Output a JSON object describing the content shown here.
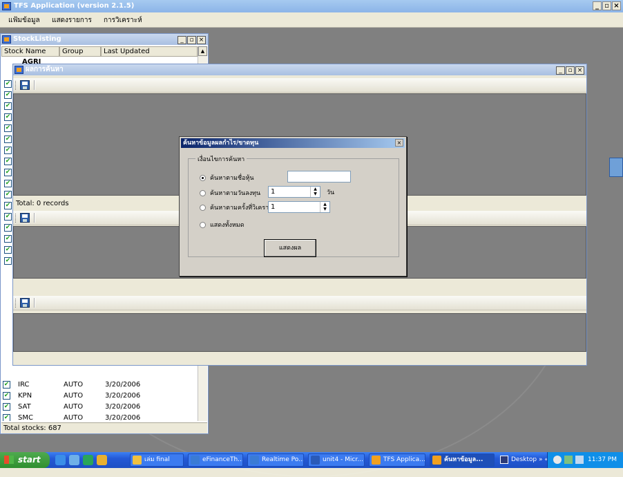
{
  "app": {
    "title": "TFS Application (version 2.1.5)",
    "minimize": "_",
    "restore": "▫",
    "close": "×"
  },
  "menu": {
    "items": [
      "แฟ้มข้อมูล",
      "แสดงรายการ",
      "การวิเคราะห์"
    ]
  },
  "stock_window": {
    "title": "StockListing",
    "columns": [
      "Stock Name",
      "Group",
      "Last Updated"
    ],
    "first_row": "AGRI",
    "rows": [
      {
        "name": "IRC",
        "group": "AUTO",
        "date": "3/20/2006"
      },
      {
        "name": "KPN",
        "group": "AUTO",
        "date": "3/20/2006"
      },
      {
        "name": "SAT",
        "group": "AUTO",
        "date": "3/20/2006"
      },
      {
        "name": "SMC",
        "group": "AUTO",
        "date": "3/20/2006"
      }
    ],
    "total": "Total stocks: 687"
  },
  "result_window": {
    "title": "ผลการค้นหา",
    "records_label": "Total: 0 records"
  },
  "dialog": {
    "title": "ค้นหาข้อมูลผลกำไร/ขาดทุน",
    "group_label": "เงื่อนไขการค้นหา",
    "options": [
      {
        "label": "ค้นหาตามชื่อหุ้น",
        "selected": true
      },
      {
        "label": "ค้นหาตามวันลงทุน",
        "selected": false
      },
      {
        "label": "ค้นหาตามครั้งที่วิเคราะห์",
        "selected": false
      },
      {
        "label": "แสดงทั้งหมด",
        "selected": false
      }
    ],
    "stock_name_value": "",
    "days_value": "1",
    "days_unit": "วัน",
    "analysis_value": "1",
    "button_label": "แสดงผล"
  },
  "taskbar": {
    "start_label": "start",
    "buttons": [
      {
        "label": "เล่ม final",
        "active": false,
        "color": "#f0c040"
      },
      {
        "label": "eFinanceTh...",
        "active": false,
        "color": "#3a7bd5"
      },
      {
        "label": "Realtime Po...",
        "active": false,
        "color": "#3a7bd5"
      },
      {
        "label": "unit4 - Micr...",
        "active": false,
        "color": "#2a5ab8"
      },
      {
        "label": "TFS Applica...",
        "active": false,
        "color": "#f0a020"
      },
      {
        "label": "ค้นหาข้อมูล...",
        "active": true,
        "color": "#f0a020"
      }
    ],
    "desktop_label": "Desktop",
    "chevrons": "»  «",
    "clock": "11:37 PM"
  }
}
